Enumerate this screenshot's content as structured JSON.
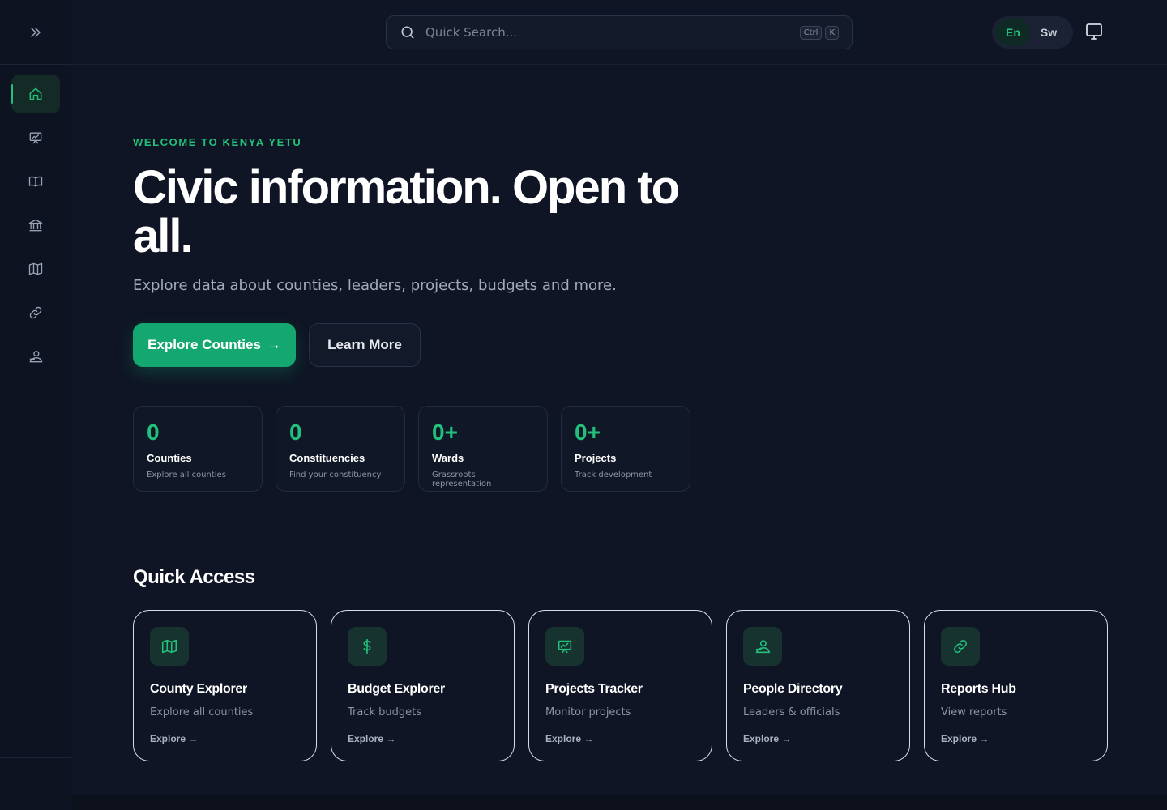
{
  "sidebar": {
    "items": [
      {
        "name": "home",
        "icon": "home-icon"
      },
      {
        "name": "projects",
        "icon": "presentation-chart-icon"
      },
      {
        "name": "reports",
        "icon": "book-icon"
      },
      {
        "name": "government",
        "icon": "building-icon"
      },
      {
        "name": "counties",
        "icon": "map-icon"
      },
      {
        "name": "links",
        "icon": "link-icon"
      },
      {
        "name": "people",
        "icon": "person-icon"
      }
    ],
    "active": "home"
  },
  "header": {
    "search_placeholder": "Quick Search...",
    "shortcut_ctrl": "Ctrl",
    "shortcut_key": "K",
    "lang_en": "En",
    "lang_sw": "Sw",
    "active_lang": "En"
  },
  "hero": {
    "eyebrow": "WELCOME TO KENYA YETU",
    "title": "Civic information. Open to all.",
    "subtitle": "Explore data about counties, leaders, projects, budgets and more.",
    "primary_button": "Explore Counties",
    "primary_arrow": "→",
    "secondary_button": "Learn More"
  },
  "stats": [
    {
      "value": "0",
      "label": "Counties",
      "desc": "Explore all counties"
    },
    {
      "value": "0",
      "label": "Constituencies",
      "desc": "Find your constituency"
    },
    {
      "value": "0+",
      "label": "Wards",
      "desc": "Grassroots representation"
    },
    {
      "value": "0+",
      "label": "Projects",
      "desc": "Track development"
    }
  ],
  "quick_access": {
    "title": "Quick Access",
    "cards": [
      {
        "name": "County Explorer",
        "desc": "Explore all counties",
        "link": "Explore →",
        "icon": "map-icon"
      },
      {
        "name": "Budget Explorer",
        "desc": "Track budgets",
        "link": "Explore →",
        "icon": "dollar-icon"
      },
      {
        "name": "Projects Tracker",
        "desc": "Monitor projects",
        "link": "Explore →",
        "icon": "presentation-chart-icon"
      },
      {
        "name": "People Directory",
        "desc": "Leaders & officials",
        "link": "Explore →",
        "icon": "person-icon"
      },
      {
        "name": "Reports Hub",
        "desc": "View reports",
        "link": "Explore →",
        "icon": "link-icon"
      }
    ]
  },
  "colors": {
    "accent": "#22c07a",
    "background": "#0f1524",
    "primary_button": "#14a870"
  }
}
